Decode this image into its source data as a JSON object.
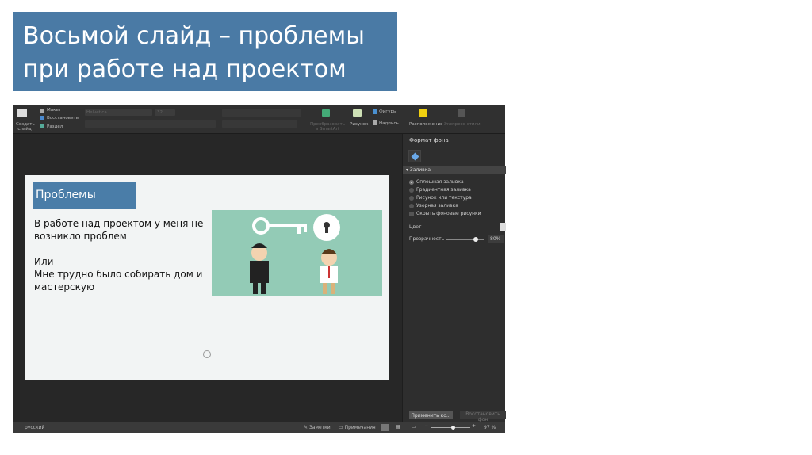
{
  "title": "Восьмой слайд – проблемы при работе над проектом",
  "ribbon": {
    "new_slide": "Создать слайд",
    "layout": "Макет",
    "reset": "Восстановить",
    "section": "Раздел",
    "font": "Helvetica",
    "size": "32",
    "convert_smartart": "Преобразовать в SmartArt",
    "picture": "Рисунок",
    "shapes": "Фигуры",
    "textbox": "Надпись",
    "arrange": "Расположение",
    "quick_styles": "Экспресс-стили"
  },
  "slide": {
    "heading": "Проблемы",
    "para1": "В работе над проектом у меня не возникло проблем",
    "para2": "Или",
    "para3": "Мне трудно было собирать дом и мастерскую"
  },
  "panel": {
    "title": "Формат фона",
    "section": "Заливка",
    "options": [
      "Сплошная заливка",
      "Градиентная заливка",
      "Рисунок или текстура",
      "Узорная заливка"
    ],
    "hide_bg": "Скрыть фоновые рисунки",
    "color": "Цвет",
    "transparency": "Прозрачность",
    "transparency_value": "80%",
    "apply_all": "Применить ко...",
    "reset_bg": "Восстановить фон"
  },
  "status": {
    "language": "русский",
    "notes": "Заметки",
    "comments": "Примечания",
    "zoom": "97 %",
    "zoom_fraction": 0.55
  },
  "colors": {
    "title_bg": "#4a7aa5",
    "picture_bg": "#93cbb6"
  }
}
